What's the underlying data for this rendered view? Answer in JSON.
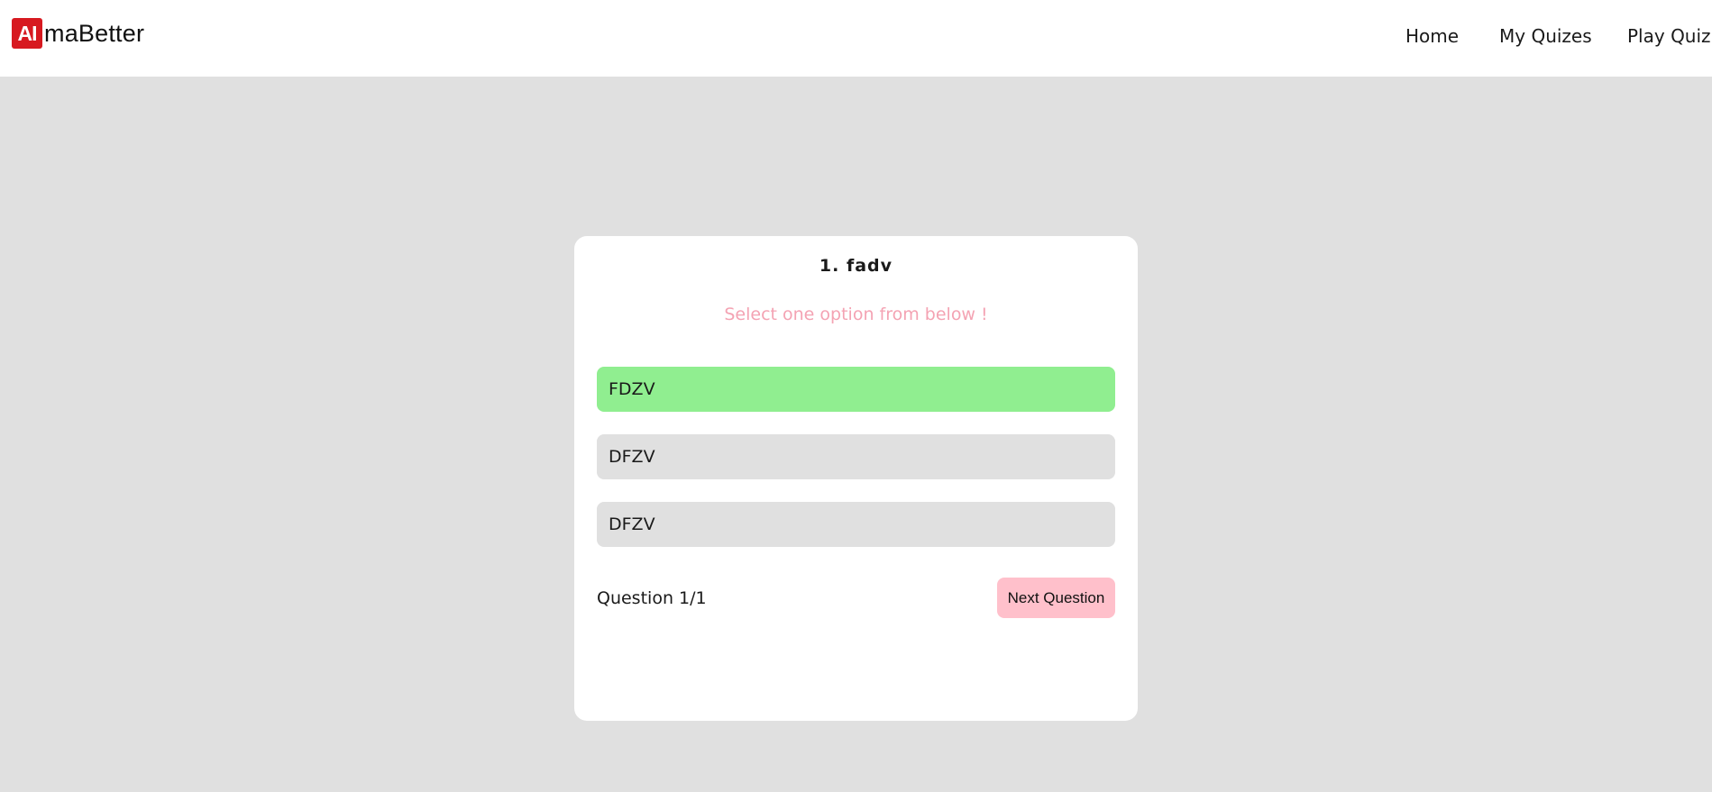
{
  "brand": {
    "badge": "AI",
    "name": "maBetter",
    "badge_color": "#d71920"
  },
  "nav": {
    "items": [
      {
        "label": "Home"
      },
      {
        "label": "My Quizes"
      },
      {
        "label": "Play Quiz"
      }
    ]
  },
  "quiz": {
    "question_title": "1. fadv",
    "instruction": "Select one option from below !",
    "options": [
      {
        "label": "FDZV",
        "selected": true
      },
      {
        "label": "DFZV",
        "selected": false
      },
      {
        "label": "DFZV",
        "selected": false
      }
    ],
    "counter": "Question 1/1",
    "next_label": "Next Question"
  },
  "colors": {
    "page_background": "#e0e0e0",
    "selected_option": "#90ee90",
    "option_default": "#e0e0e0",
    "instruction_text": "#f4a3b3",
    "next_button": "#ffc0cb"
  }
}
